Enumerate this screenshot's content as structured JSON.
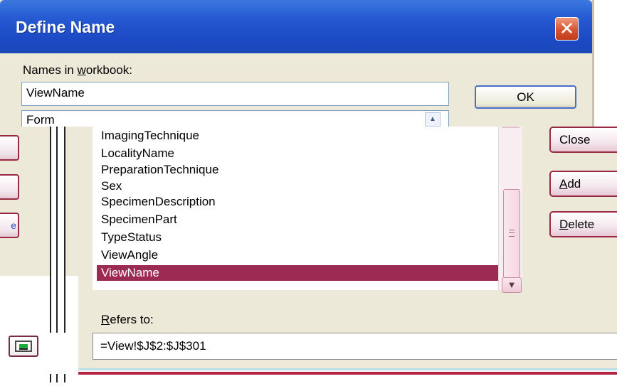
{
  "window": {
    "title": "Define Name",
    "close_glyph": "✕"
  },
  "names_label_pre": "Names in ",
  "names_label_accel": "w",
  "names_label_post": "orkbook:",
  "name_input_value": "ViewName",
  "list_first_visible": "Form",
  "ok_label": "OK",
  "list_items": [
    "ImagingTechnique",
    "LocalityName",
    "PreparationTechnique",
    "Sex",
    "SpecimenDescription",
    "SpecimenPart",
    "TypeStatus",
    "ViewAngle",
    "ViewName"
  ],
  "selected_item": "ViewName",
  "buttons": {
    "close": "Close",
    "add_accel": "A",
    "add_rest": "dd",
    "delete_accel": "D",
    "delete_rest": "elete",
    "left_partial_glyph": "e"
  },
  "refers_label_accel": "R",
  "refers_label_rest": "efers to:",
  "refers_value": "=View!$J$2:$J$301",
  "icons": {
    "close": "close-icon",
    "scroll_down": "chevron-down-icon",
    "collapse": "collapse-dialog-icon"
  },
  "colors": {
    "titlebar": "#2659d2",
    "selection": "#9c2a52",
    "dialog_bg": "#ece9d8"
  }
}
